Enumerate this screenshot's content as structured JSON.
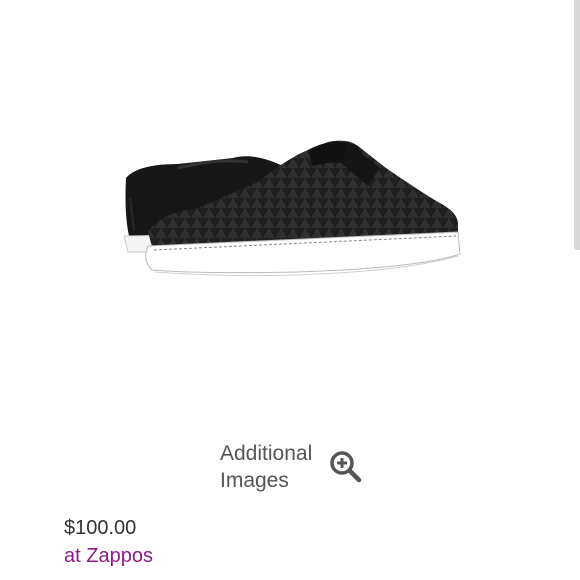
{
  "product": {
    "image_alt": "Black quilted slip-on sneakers",
    "price": "$100.00",
    "retailer_link": "at Zappos"
  },
  "gallery": {
    "label_line1": "Additional",
    "label_line2": "Images",
    "icon": "zoom-in-icon"
  },
  "colors": {
    "retailer_link": "#8e1a8a",
    "text": "#555555",
    "shoe": "#1c1c1c",
    "sole": "#ffffff"
  }
}
